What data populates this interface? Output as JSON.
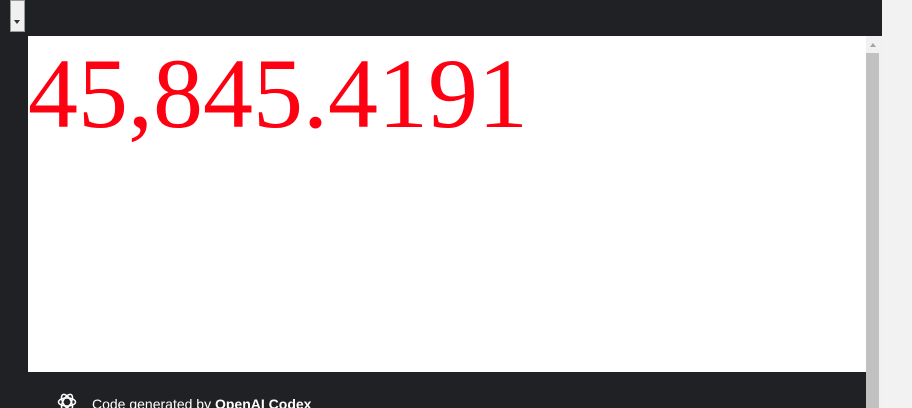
{
  "output": {
    "value": "45,845.4191",
    "color": "#ff0012"
  },
  "footer": {
    "prefix": "Code generated by ",
    "brand": "OpenAI Codex",
    "logo_icon": "openai-logo-icon"
  },
  "theme": {
    "dark_background": "#202124",
    "output_background": "#ffffff"
  }
}
